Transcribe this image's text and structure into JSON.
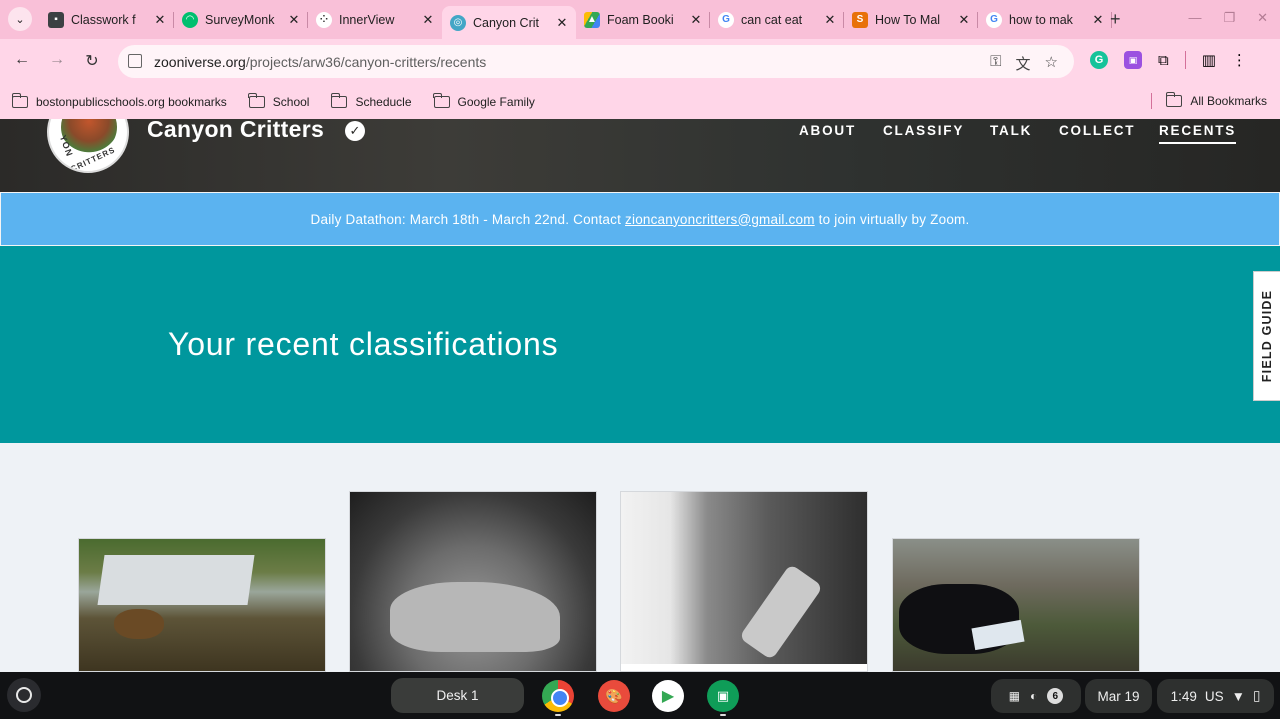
{
  "browser": {
    "tabs": [
      {
        "title": "Classwork f",
        "favicon_color": "#3c4043",
        "active": false
      },
      {
        "title": "SurveyMonk",
        "favicon_color": "#00bf6f",
        "active": false
      },
      {
        "title": "InnerView",
        "favicon_color": "#ffffff",
        "active": false
      },
      {
        "title": "Canyon Crit",
        "favicon_color": "#43a6c6",
        "active": true
      },
      {
        "title": "Foam Booki",
        "favicon_color": "#fbbc05",
        "active": false
      },
      {
        "title": "can cat eat",
        "favicon_color": "#4285f4",
        "active": false
      },
      {
        "title": "How To Mal",
        "favicon_color": "#e8710a",
        "active": false
      },
      {
        "title": "how to mak",
        "favicon_color": "#4285f4",
        "active": false
      }
    ],
    "url_host": "zooniverse.org",
    "url_path": "/projects/arw36/canyon-critters/recents",
    "bookmarks": [
      "bostonpublicschools.org bookmarks",
      "School",
      "Scheducle",
      "Google Family"
    ],
    "all_bookmarks": "All Bookmarks"
  },
  "site": {
    "project_title": "Canyon Critters",
    "logo_text_top": "YON",
    "logo_text_bottom": "CRITTERS",
    "nav": [
      {
        "label": "ABOUT",
        "active": false
      },
      {
        "label": "CLASSIFY",
        "active": false
      },
      {
        "label": "TALK",
        "active": false
      },
      {
        "label": "COLLECT",
        "active": false
      },
      {
        "label": "RECENTS",
        "active": true
      }
    ],
    "announcement": {
      "before": "Daily Datathon: March 18th - March 22nd. Contact",
      "email": "zioncanyoncritters@gmail.com",
      "after": "to join virtually by Zoom."
    },
    "heading": "Your recent classifications",
    "field_guide": "FIELD GUIDE",
    "colors": {
      "hero": "#00979d",
      "announce": "#5bb3f0"
    }
  },
  "shelf": {
    "desk_label": "Desk 1",
    "notification_count": "6",
    "date": "Mar 19",
    "time": "1:49",
    "locale": "US"
  }
}
